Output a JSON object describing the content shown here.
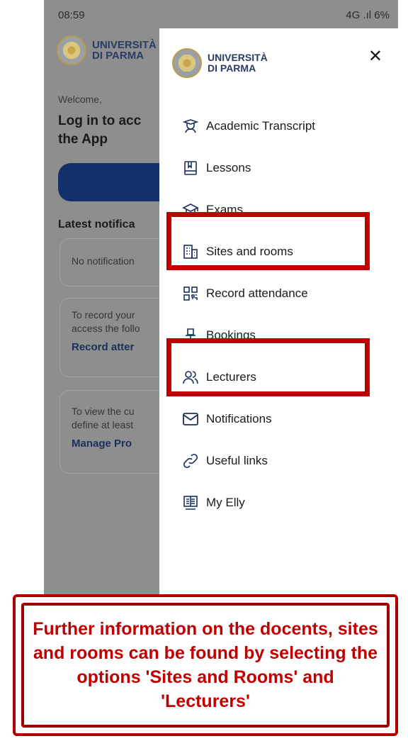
{
  "status_bar": {
    "time": "08:59",
    "right": "4G .ıl 6%"
  },
  "background": {
    "logo_text_line1": "UNIVERSITÀ",
    "logo_text_line2": "DI PARMA",
    "welcome": "Welcome,",
    "title": "Log in to acc the App",
    "latest": "Latest notifica",
    "card1_text": "No notification",
    "card2_text": "To record your access the follo",
    "card2_link": "Record atter",
    "card3_text": "To view the cu define at least",
    "card3_link": "Manage Pro"
  },
  "drawer": {
    "logo_text_line1": "UNIVERSITÀ",
    "logo_text_line2": "DI PARMA",
    "close": "✕",
    "items": [
      {
        "label": "Academic Transcript",
        "icon": "graduate-icon"
      },
      {
        "label": "Lessons",
        "icon": "book-icon"
      },
      {
        "label": "Exams",
        "icon": "mortarboard-icon"
      },
      {
        "label": "Sites and rooms",
        "icon": "building-icon"
      },
      {
        "label": "Record attendance",
        "icon": "qr-code-icon"
      },
      {
        "label": "Bookings",
        "icon": "chair-icon"
      },
      {
        "label": "Lecturers",
        "icon": "people-icon"
      },
      {
        "label": "Notifications",
        "icon": "mail-icon"
      },
      {
        "label": "Useful links",
        "icon": "link-icon"
      },
      {
        "label": "My Elly",
        "icon": "elly-icon"
      }
    ]
  },
  "callout": {
    "text": "Further information on the docents, sites and rooms can be found by selecting the options 'Sites and Rooms' and 'Lecturers'"
  },
  "colors": {
    "highlight": "#c00000",
    "brand": "#2b3b66",
    "overlay": "#8e8e8e"
  }
}
